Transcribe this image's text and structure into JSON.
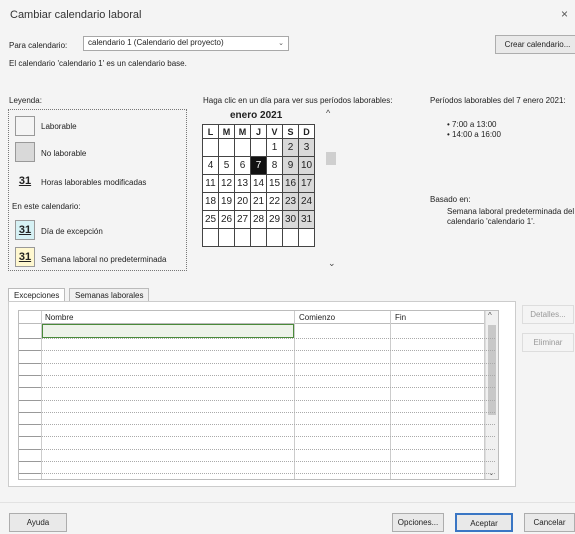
{
  "window": {
    "title": "Cambiar calendario laboral",
    "close_glyph": "×"
  },
  "calendar_select": {
    "label": "Para calendario:",
    "value": "calendario 1 (Calendario del proyecto)",
    "chevron": "⌄"
  },
  "create_button": "Crear calendario...",
  "base_note": "El calendario 'calendario 1' es un calendario base.",
  "legend": {
    "label": "Leyenda:",
    "items": [
      {
        "text": "Laborable",
        "swatch": "#ffffff"
      },
      {
        "text": "No laborable",
        "swatch": "#d9d9d9"
      },
      {
        "text": "Horas laborables modificadas",
        "num": "31"
      }
    ],
    "section_label": "En este calendario:",
    "items2": [
      {
        "text": "Día de excepción",
        "num": "31",
        "swatch": "#d6f1f4"
      },
      {
        "text": "Semana laboral no predeterminada",
        "num": "31",
        "swatch": "#fff8d0"
      }
    ]
  },
  "calendar": {
    "hint": "Haga clic en un día para ver sus períodos laborables:",
    "month": "enero 2021",
    "days_header": [
      "L",
      "M",
      "M",
      "J",
      "V",
      "S",
      "D"
    ],
    "weeks": [
      [
        "",
        "",
        "",
        "",
        "1",
        "2",
        "3"
      ],
      [
        "4",
        "5",
        "6",
        "7",
        "8",
        "9",
        "10"
      ],
      [
        "11",
        "12",
        "13",
        "14",
        "15",
        "16",
        "17"
      ],
      [
        "18",
        "19",
        "20",
        "21",
        "22",
        "23",
        "24"
      ],
      [
        "25",
        "26",
        "27",
        "28",
        "29",
        "30",
        "31"
      ],
      [
        "",
        "",
        "",
        "",
        "",
        "",
        ""
      ]
    ],
    "selected_day": "7",
    "scroll_up": "^",
    "scroll_down": "⌄"
  },
  "periods": {
    "title": "Períodos laborables del 7 enero 2021:",
    "items": [
      "• 7:00 a 13:00",
      "• 14:00 a 16:00"
    ],
    "based_label": "Basado en:",
    "based_text": "Semana laboral predeterminada del calendario 'calendario 1'."
  },
  "tabs": [
    "Excepciones",
    "Semanas laborales"
  ],
  "table": {
    "headers": [
      "Nombre",
      "Comienzo",
      "Fin"
    ],
    "row_count": 12
  },
  "side_buttons": {
    "details": "Detalles...",
    "delete": "Eliminar"
  },
  "footer": {
    "help": "Ayuda",
    "options": "Opciones...",
    "accept": "Aceptar",
    "cancel": "Cancelar"
  }
}
